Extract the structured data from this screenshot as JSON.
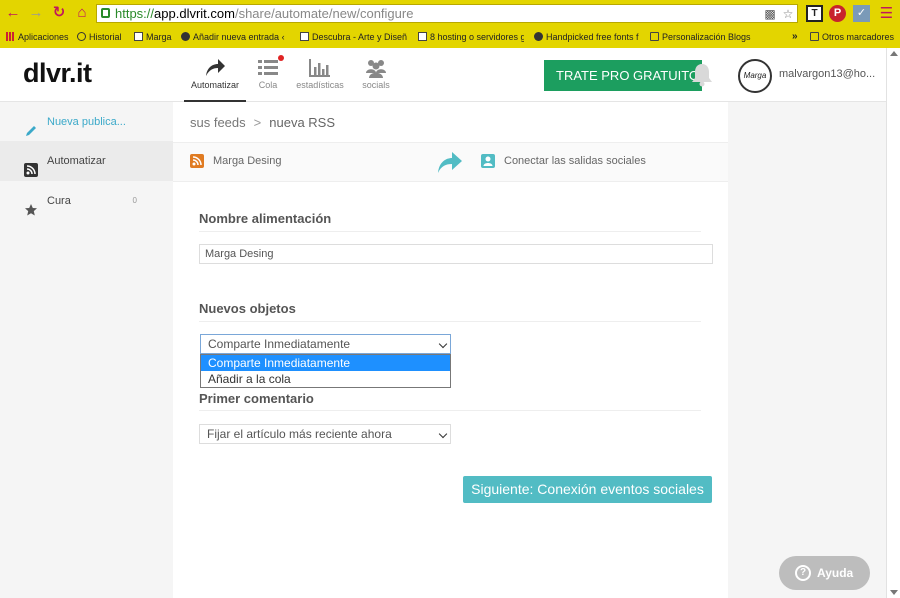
{
  "browser": {
    "url": {
      "scheme": "https://",
      "host": "app.dlvrit.com",
      "path": "/share/automate/new/configure"
    },
    "bookmarks": [
      {
        "label": "Aplicaciones",
        "icon": "apps-grid-icon"
      },
      {
        "label": "Historial",
        "icon": "history-clock-icon"
      },
      {
        "label": "Marga",
        "icon": "page-icon"
      },
      {
        "label": "Añadir nueva entrada ‹",
        "icon": "panda-icon"
      },
      {
        "label": "Descubra - Arte y Diseñ",
        "icon": "page-icon"
      },
      {
        "label": "8 hosting o servidores g",
        "icon": "page-icon"
      },
      {
        "label": "Handpicked free fonts f",
        "icon": "fonts-icon"
      },
      {
        "label": "Personalización Blogs",
        "icon": "folder-icon"
      },
      {
        "label": "»",
        "icon": ""
      },
      {
        "label": "Otros marcadores",
        "icon": "folder-icon"
      }
    ],
    "colors": {
      "chrome": "#e3d500",
      "nav_icons": "#c0185b"
    }
  },
  "header": {
    "logo": "dlvr.it",
    "nav": [
      {
        "label": "Automatizar",
        "icon": "share-arrow-icon",
        "active": true
      },
      {
        "label": "Cola",
        "icon": "queue-list-icon",
        "active": false
      },
      {
        "label": "estadísticas",
        "icon": "bar-chart-icon",
        "active": false
      },
      {
        "label": "socials",
        "icon": "people-icon",
        "active": false
      }
    ],
    "pro_button": "TRATE PRO GRATUITO",
    "avatar_text": "Marga",
    "user_email": "malvargon13@ho..."
  },
  "sidebar": {
    "items": [
      {
        "label": "Nueva publica...",
        "icon": "pencil-icon"
      },
      {
        "label": "Automatizar",
        "icon": "rss-icon"
      },
      {
        "label": "Cura",
        "icon": "star-icon",
        "count": "0"
      }
    ]
  },
  "main": {
    "breadcrumb": {
      "parent": "sus feeds",
      "separator": ">",
      "current": "nueva RSS"
    },
    "steps": {
      "source": "Marga Desing",
      "target": "Conectar las salidas sociales"
    },
    "feed_name": {
      "title": "Nombre alimentación",
      "value": "Marga Desing"
    },
    "new_items": {
      "title": "Nuevos objetos",
      "selected": "Comparte Inmediatamente",
      "options": [
        "Comparte Inmediatamente",
        "Añadir a la cola"
      ]
    },
    "first_comment": {
      "title": "Primer comentario",
      "selected": "Fijar el artículo más reciente ahora"
    },
    "next_button": "Siguiente: Conexión eventos sociales"
  },
  "help": {
    "label": "Ayuda"
  },
  "colors": {
    "accent_green": "#1c9e5f",
    "accent_teal": "#52bcc4",
    "selection_blue": "#1e90ff",
    "rss_orange": "#e07b22"
  }
}
